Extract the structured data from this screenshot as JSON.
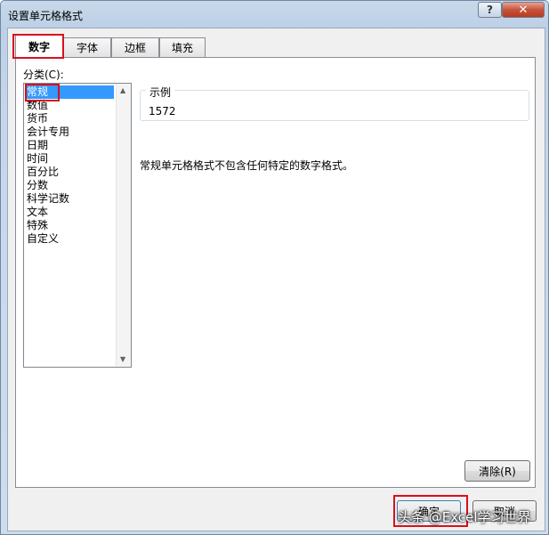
{
  "window": {
    "title": "设置单元格格式",
    "help_label": "?",
    "close_label": "✕"
  },
  "tabs": [
    {
      "label": "数字",
      "active": true
    },
    {
      "label": "字体"
    },
    {
      "label": "边框"
    },
    {
      "label": "填充"
    }
  ],
  "category": {
    "label": "分类(C):",
    "items": [
      "常规",
      "数值",
      "货币",
      "会计专用",
      "日期",
      "时间",
      "百分比",
      "分数",
      "科学记数",
      "文本",
      "特殊",
      "自定义"
    ],
    "selected": "常规"
  },
  "sample": {
    "label": "示例",
    "value": "1572"
  },
  "description": "常规单元格格式不包含任何特定的数字格式。",
  "buttons": {
    "clear": "清除(R)",
    "ok": "确定",
    "cancel": "取消"
  },
  "watermark": "头条 @Excel学习世界",
  "colors": {
    "highlight_box": "#d8101c",
    "selection": "#3399ff"
  }
}
